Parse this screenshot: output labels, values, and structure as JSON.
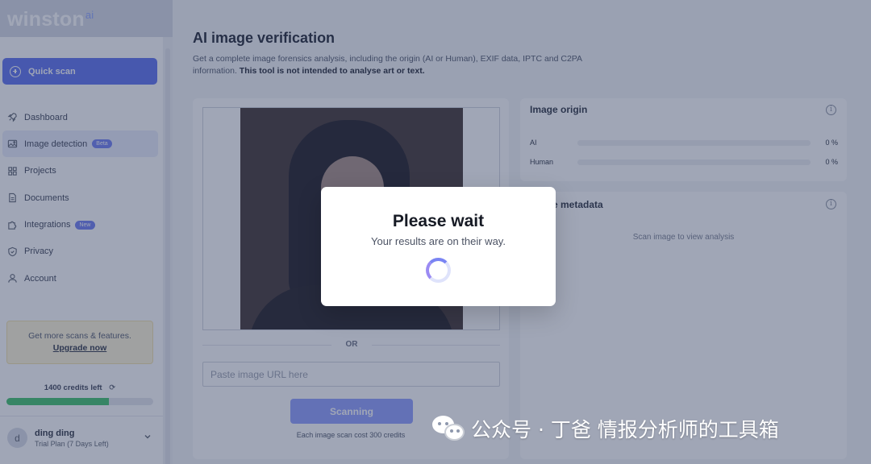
{
  "sidebar": {
    "logo": "winston",
    "logo_suffix": "ai",
    "quick_scan": "Quick scan",
    "items": [
      {
        "label": "Dashboard",
        "icon": "rocket-icon"
      },
      {
        "label": "Image detection",
        "icon": "image-icon",
        "badge": "Beta"
      },
      {
        "label": "Projects",
        "icon": "grid-icon"
      },
      {
        "label": "Documents",
        "icon": "document-icon"
      },
      {
        "label": "Integrations",
        "icon": "puzzle-icon",
        "badge": "New"
      },
      {
        "label": "Privacy",
        "icon": "shield-icon"
      },
      {
        "label": "Account",
        "icon": "user-icon"
      }
    ],
    "upgrade": {
      "text": "Get more scans & features.",
      "link": "Upgrade now"
    },
    "credits": {
      "label": "1400 credits left",
      "fraction": 0.7
    },
    "user": {
      "initial": "d",
      "name": "ding ding",
      "plan": "Trial Plan (7 Days Left)"
    }
  },
  "main": {
    "title": "AI image verification",
    "description": "Get a complete image forensics analysis, including the origin (AI or Human), EXIF data, IPTC and C2PA information.",
    "description_bold": "This tool is not intended to analyse art or text.",
    "upload": {
      "or": "OR",
      "url_placeholder": "Paste image URL here",
      "scan_button": "Scanning",
      "cost_note": "Each image scan cost 300 credits"
    },
    "origin": {
      "title": "Image origin",
      "rows": [
        {
          "label": "AI",
          "value": "0 %"
        },
        {
          "label": "Human",
          "value": "0 %"
        }
      ]
    },
    "metadata": {
      "title": "Image metadata",
      "empty": "Scan image to view analysis"
    }
  },
  "modal": {
    "title": "Please wait",
    "subtitle": "Your results are on their way."
  },
  "watermark": "公众号 · 丁爸 情报分析师的工具箱"
}
